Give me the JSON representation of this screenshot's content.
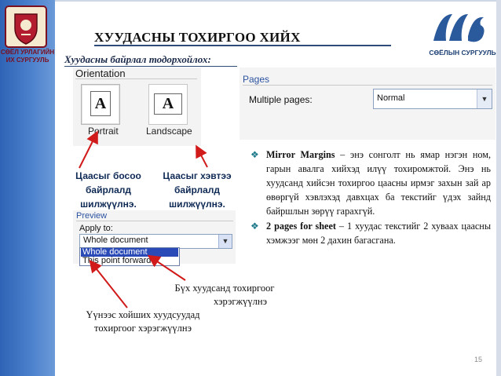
{
  "title": "ХУУДАСНЫ ТОХИРГОО ХИЙХ",
  "subtitle": "Хуудасны байрлал тодорхойлох:",
  "logos": {
    "left_text": [
      "СӨЁЛ УРЛАГИЙН",
      "ИХ СУРГУУЛЬ"
    ],
    "right_text": "СӨЁЛЫН СУРГУУЛЬ"
  },
  "orientation": {
    "title": "Orientation",
    "portrait_label": "Portrait",
    "landscape_label": "Landscape",
    "page_letter": "A"
  },
  "pages_dialog": {
    "title": "Pages",
    "label": "Multiple pages:",
    "value": "Normal"
  },
  "notes": {
    "portrait": [
      "Цаасыг босоо",
      "байрлалд",
      "шилжүүлнэ."
    ],
    "landscape": [
      "Цаасыг хэвтээ",
      "байрлалд",
      "шилжүүлнэ."
    ]
  },
  "preview_dialog": {
    "title": "Preview",
    "apply_label": "Apply to:",
    "selected_value": "Whole document",
    "options": [
      "Whole document",
      "This point forward"
    ]
  },
  "bullets": [
    {
      "term": "Mirror Margins",
      "text": " – энэ сонголт нь ямар нэгэн ном, гарын авалга хийхэд илүү тохиромжтой. Энэ нь хуудсанд хийсэн тохиргоо цаасны ирмэг захын зай ар өвөргүй хэвлэхэд давхцах ба текстийг үдэх зайнд байршлын зөрүү гарахгүй."
    },
    {
      "term": "2 pages for sheet",
      "text": " – 1 хуудас текстийг 2 хуваах цаасны хэмжээг мөн 2 дахин багасгана."
    }
  ],
  "captions": {
    "whole": [
      "Бүх хуудсанд тохиргоог",
      "хэрэгжүүлнэ"
    ],
    "forward": [
      "Үүнээс хойших хуудсуудад",
      "тохиргоог хэрэгжүүлнэ"
    ]
  },
  "page_number": "15",
  "colors": {
    "sidebar": "#3a6fbe",
    "arrow": "#d11a1a",
    "title_rule": "#2f4b7a",
    "selection": "#2a4ab7"
  }
}
